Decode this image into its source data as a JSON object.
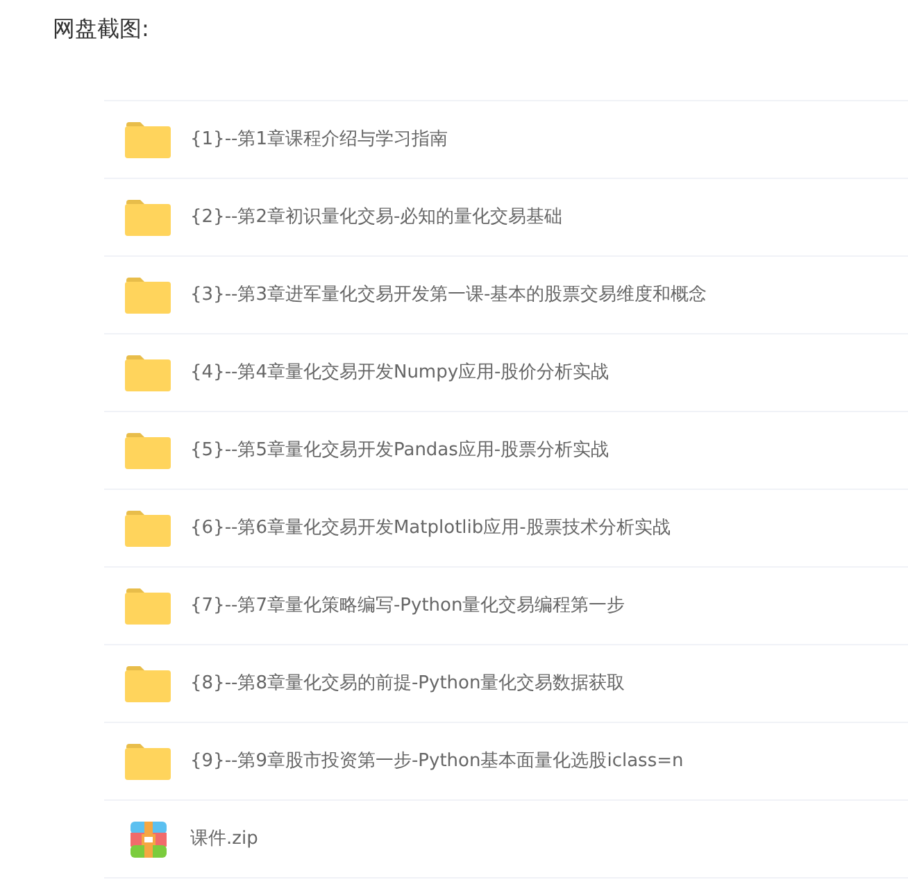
{
  "heading": "网盘截图:",
  "files": [
    {
      "kind": "folder",
      "name": "{1}--第1章课程介绍与学习指南"
    },
    {
      "kind": "folder",
      "name": "{2}--第2章初识量化交易-必知的量化交易基础"
    },
    {
      "kind": "folder",
      "name": "{3}--第3章进军量化交易开发第一课-基本的股票交易维度和概念"
    },
    {
      "kind": "folder",
      "name": "{4}--第4章量化交易开发Numpy应用-股价分析实战"
    },
    {
      "kind": "folder",
      "name": "{5}--第5章量化交易开发Pandas应用-股票分析实战"
    },
    {
      "kind": "folder",
      "name": "{6}--第6章量化交易开发Matplotlib应用-股票技术分析实战"
    },
    {
      "kind": "folder",
      "name": "{7}--第7章量化策略编写-Python量化交易编程第一步"
    },
    {
      "kind": "folder",
      "name": "{8}--第8章量化交易的前提-Python量化交易数据获取"
    },
    {
      "kind": "folder",
      "name": "{9}--第9章股市投资第一步-Python基本面量化选股iclass=n"
    },
    {
      "kind": "zip",
      "name": "课件.zip"
    }
  ]
}
